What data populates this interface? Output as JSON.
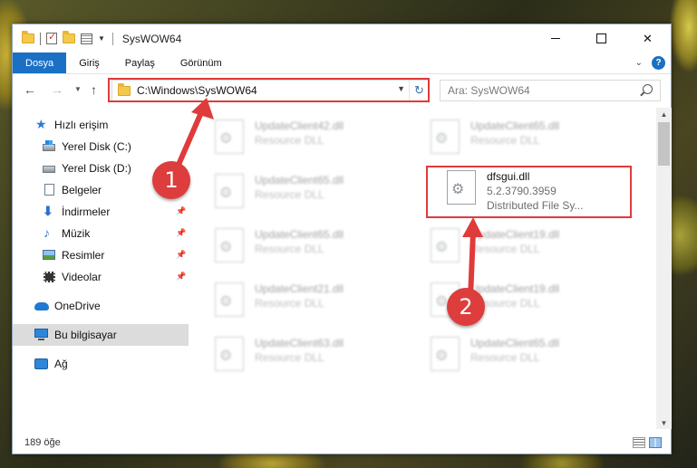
{
  "window": {
    "title": "SysWOW64",
    "controls": {
      "close": "✕"
    }
  },
  "ribbon": {
    "tabs": [
      "Dosya",
      "Giriş",
      "Paylaş",
      "Görünüm"
    ],
    "help": "?"
  },
  "navigation": {
    "address": "C:\\Windows\\SysWOW64",
    "search_placeholder": "Ara: SysWOW64"
  },
  "sidebar": {
    "items": [
      {
        "label": "Hızlı erişim",
        "icon": "star-icon"
      },
      {
        "label": "Yerel Disk (C:)",
        "icon": "drive-icon"
      },
      {
        "label": "Yerel Disk (D:)",
        "icon": "drive-icon"
      },
      {
        "label": "Belgeler",
        "icon": "document-icon",
        "pinned": true
      },
      {
        "label": "İndirmeler",
        "icon": "download-icon",
        "pinned": true
      },
      {
        "label": "Müzik",
        "icon": "music-icon",
        "pinned": true
      },
      {
        "label": "Resimler",
        "icon": "pictures-icon",
        "pinned": true
      },
      {
        "label": "Videolar",
        "icon": "videos-icon",
        "pinned": true
      },
      {
        "label": "OneDrive",
        "icon": "cloud-icon"
      },
      {
        "label": "Bu bilgisayar",
        "icon": "computer-icon",
        "selected": true
      },
      {
        "label": "Ağ",
        "icon": "network-icon"
      }
    ]
  },
  "files": [
    {
      "name": "UpdateClient42.dll",
      "type": "Resource DLL"
    },
    {
      "name": "UpdateClient65.dll",
      "type": "Resource DLL"
    },
    {
      "name": "UpdateClient65.dll",
      "type": "Resource DLL"
    },
    {
      "name": "dfsgui.dll",
      "version": "5.2.3790.3959",
      "description": "Distributed File Sy..."
    },
    {
      "name": "UpdateClient65.dll",
      "type": "Resource DLL"
    },
    {
      "name": "UpdateClient19.dll",
      "type": "Resource DLL"
    },
    {
      "name": "UpdateClient21.dll",
      "type": "Resource DLL"
    },
    {
      "name": "UpdateClient19.dll",
      "type": "Resource DLL"
    },
    {
      "name": "UpdateClient63.dll",
      "type": "Resource DLL"
    },
    {
      "name": "UpdateClient65.dll",
      "type": "Resource DLL"
    }
  ],
  "status": {
    "item_count": "189 öğe"
  },
  "annotations": {
    "marker_1": "1",
    "marker_2": "2",
    "color": "#e03b3b"
  }
}
